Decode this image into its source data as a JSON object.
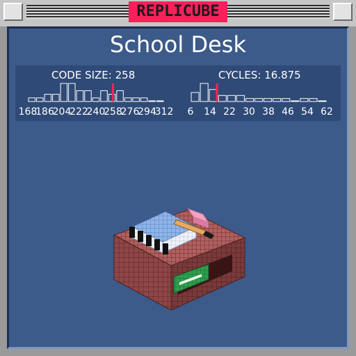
{
  "app": {
    "title": "REPLICUBE"
  },
  "level": {
    "name": "School Desk"
  },
  "code_size": {
    "label": "CODE SIZE:",
    "value": "258",
    "ticks": [
      "168",
      "186",
      "204",
      "222",
      "240",
      "258",
      "276",
      "294",
      "312"
    ]
  },
  "cycles": {
    "label": "CYCLES:",
    "value": "16.875",
    "ticks": [
      "6",
      "14",
      "22",
      "30",
      "38",
      "46",
      "54",
      "62"
    ]
  },
  "chart_data": [
    {
      "type": "bar",
      "xlabel": "CODE SIZE",
      "x_ticks": [
        168,
        186,
        204,
        222,
        240,
        258,
        276,
        294,
        312
      ],
      "bin_width": 9,
      "bins_start": 168,
      "values": [
        1,
        1,
        2,
        2,
        5,
        5,
        3,
        3,
        1,
        3,
        2,
        3,
        1,
        1,
        1,
        0,
        0
      ],
      "marker": 258,
      "marker_color": "#ff1f5a"
    },
    {
      "type": "bar",
      "xlabel": "CYCLES",
      "x_ticks": [
        6,
        14,
        22,
        30,
        38,
        46,
        54,
        62
      ],
      "bin_width": 4,
      "bins_start": 6,
      "values": [
        3,
        6,
        4,
        2,
        2,
        2,
        1,
        1,
        1,
        1,
        1,
        0,
        1,
        1,
        0
      ],
      "marker": 16.875,
      "marker_color": "#ff1f5a"
    }
  ],
  "colors": {
    "panel": "#3c5a8a",
    "stats_bg": "#2f4a76",
    "accent": "#ff1f5a"
  }
}
